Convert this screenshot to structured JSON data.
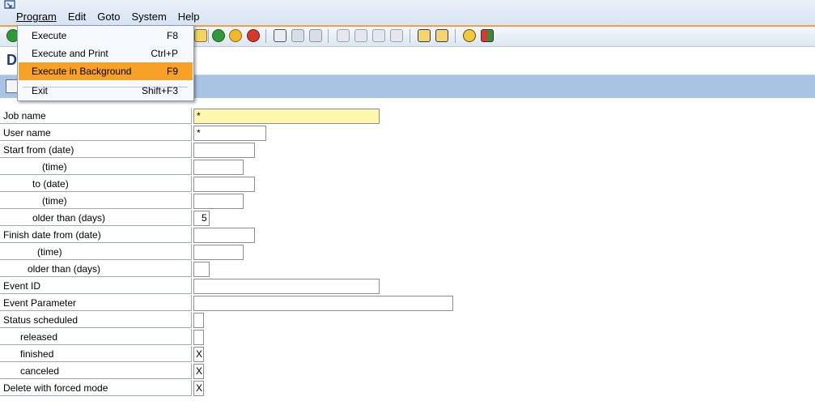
{
  "menubar": {
    "items": [
      {
        "label": "Program"
      },
      {
        "label": "Edit"
      },
      {
        "label": "Goto"
      },
      {
        "label": "System"
      },
      {
        "label": "Help"
      }
    ]
  },
  "dropdown": {
    "items": [
      {
        "label": "Execute",
        "shortcut": "F8"
      },
      {
        "label": "Execute and Print",
        "shortcut": "Ctrl+P"
      },
      {
        "label": "Execute in Background",
        "shortcut": "F9",
        "highlighted": true
      },
      {
        "label": "Exit",
        "shortcut": "Shift+F3"
      }
    ]
  },
  "title": {
    "visible_text": "D"
  },
  "form": {
    "rows": [
      {
        "label": "Job name",
        "value": "*"
      },
      {
        "label": "User name",
        "value": "*"
      },
      {
        "label": "Start from (date)",
        "value": ""
      },
      {
        "label": "(time)",
        "value": ""
      },
      {
        "label": "to (date)",
        "value": ""
      },
      {
        "label": "(time)",
        "value": ""
      },
      {
        "label": "older than (days)",
        "value": "5"
      },
      {
        "label": "Finish date from (date)",
        "value": ""
      },
      {
        "label": "(time)",
        "value": ""
      },
      {
        "label": "older than (days)",
        "value": ""
      },
      {
        "label": "Event ID",
        "value": ""
      },
      {
        "label": "Event Parameter",
        "value": ""
      },
      {
        "label": "Status scheduled",
        "value": ""
      },
      {
        "label": "released",
        "value": ""
      },
      {
        "label": "finished",
        "value": "X"
      },
      {
        "label": "canceled",
        "value": "X"
      },
      {
        "label": "Delete with forced mode",
        "value": "X"
      }
    ]
  },
  "colors": {
    "accent_orange": "#f7a127",
    "required_field": "#fff7b0",
    "app_toolbar": "#a9c3e3",
    "title_text": "#1c3e7a"
  }
}
